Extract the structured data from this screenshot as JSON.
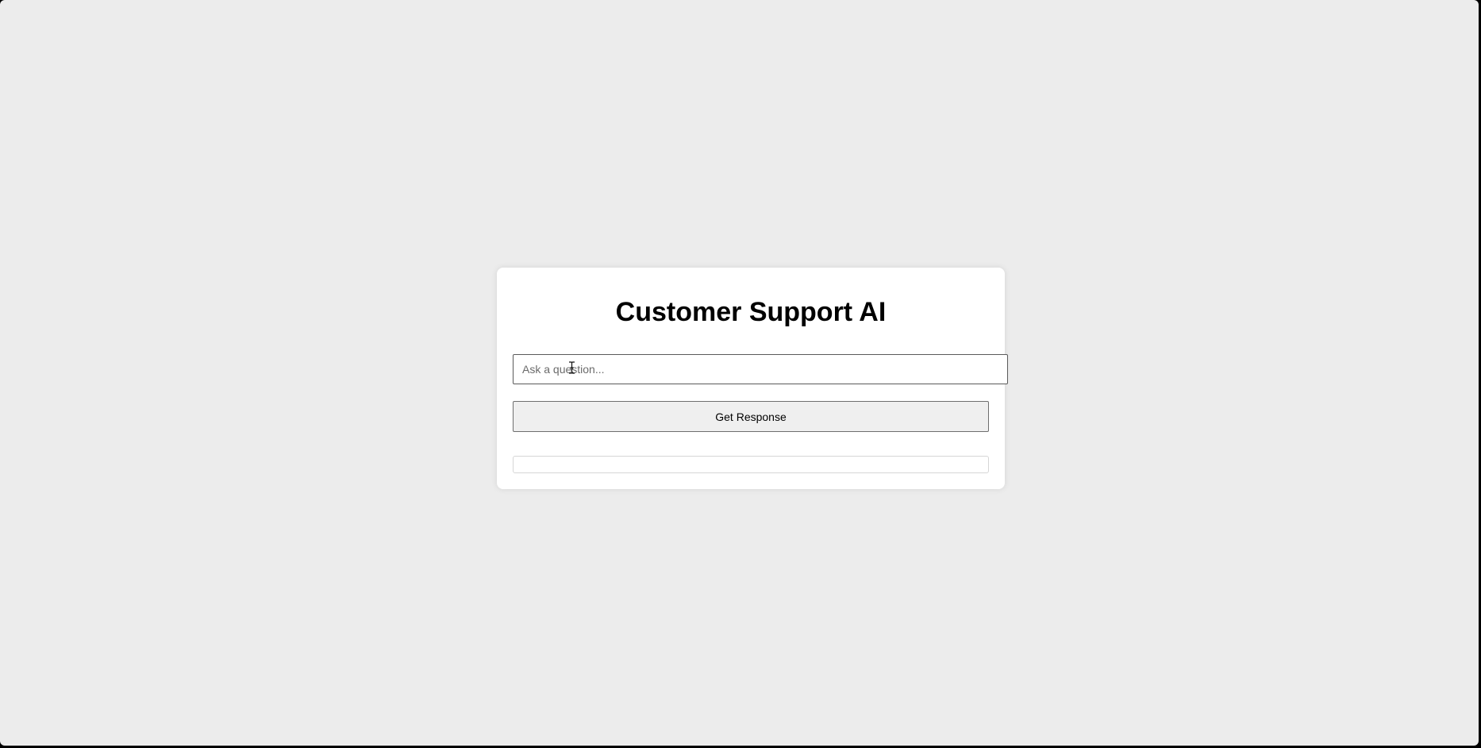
{
  "page": {
    "background_color": "#ececec",
    "card_color": "#ffffff"
  },
  "header": {
    "title": "Customer Support AI"
  },
  "form": {
    "question_placeholder": "Ask a question...",
    "question_value": "",
    "submit_label": "Get Response"
  },
  "response": {
    "text": ""
  },
  "icons": {
    "cursor": "text-cursor-icon"
  }
}
